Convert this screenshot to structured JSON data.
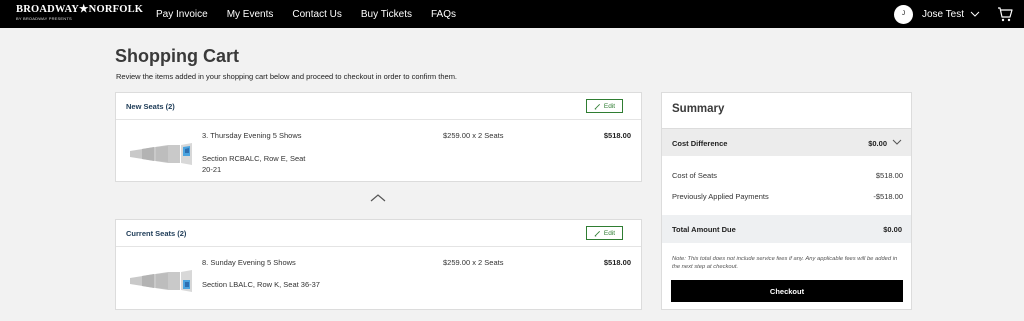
{
  "nav": {
    "logo_text": "BROADWAY★NORFOLK",
    "logo_subtext": "BY BROADWAY PRESENTS",
    "links": [
      "Pay Invoice",
      "My Events",
      "Contact Us",
      "Buy Tickets",
      "FAQs"
    ],
    "user_initial": "J",
    "user_name": "Jose Test"
  },
  "page": {
    "title": "Shopping Cart",
    "subtitle": "Review the items added in your shopping cart below and proceed to checkout in order to confirm them."
  },
  "new_seats": {
    "heading": "New Seats (2)",
    "edit_label": "Edit",
    "item": {
      "name": "3. Thursday Evening 5 Shows",
      "section_line1": "Section RCBALC, Row E, Seat",
      "section_line2": "20-21",
      "price": "$259.00 x 2 Seats",
      "total": "$518.00"
    }
  },
  "current_seats": {
    "heading": "Current Seats (2)",
    "edit_label": "Edit",
    "item": {
      "name": "8. Sunday Evening 5 Shows",
      "section_line1": "Section LBALC, Row K, Seat 36-37",
      "price": "$259.00 x 2 Seats",
      "total": "$518.00"
    }
  },
  "summary": {
    "title": "Summary",
    "cost_difference_label": "Cost Difference",
    "cost_difference_value": "$0.00",
    "cost_of_seats_label": "Cost of Seats",
    "cost_of_seats_value": "$518.00",
    "prev_payments_label": "Previously Applied Payments",
    "prev_payments_value": "-$518.00",
    "total_due_label": "Total Amount Due",
    "total_due_value": "$0.00",
    "note": "Note: This total does not include service fees if any. Any applicable fees will be added in the next step at checkout.",
    "checkout_label": "Checkout"
  },
  "colors": {
    "nav_bg": "#000000",
    "accent_green": "#2f7d32",
    "heading_blue": "#1d3b57",
    "seat_highlight": "#4aa3df"
  },
  "icons": [
    "chevron-down-icon",
    "cart-icon",
    "pencil-icon",
    "chevron-up-icon",
    "seat-map-icon"
  ]
}
